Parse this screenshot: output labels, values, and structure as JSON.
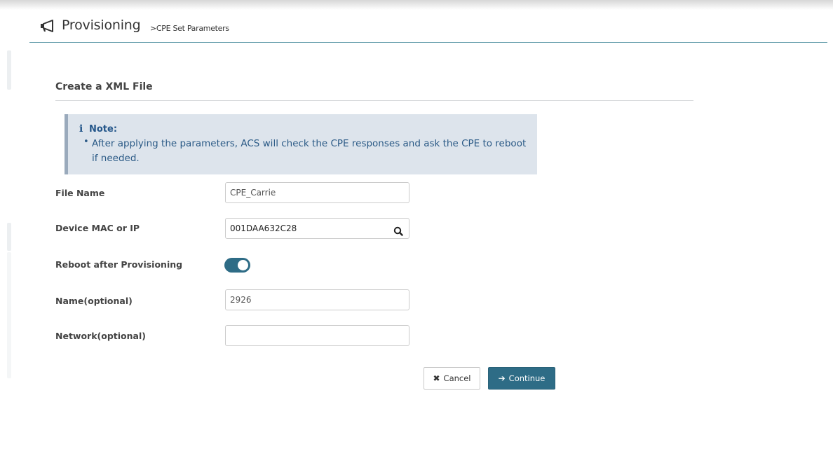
{
  "header": {
    "title": "Provisioning",
    "subtitle": ">CPE Set Parameters",
    "icon": "megaphone-icon"
  },
  "section": {
    "title": "Create a XML File"
  },
  "note": {
    "title": "Note:",
    "icon": "info-icon",
    "bullet": "•",
    "text": "After applying the parameters, ACS will check the CPE responses and ask the CPE to reboot if needed."
  },
  "form": {
    "file_name": {
      "label": "File Name",
      "value": "CPE_Carrie"
    },
    "device": {
      "label": "Device MAC or IP",
      "value": "001DAA632C28",
      "icon": "search-icon"
    },
    "reboot": {
      "label": "Reboot after Provisioning",
      "enabled": true
    },
    "name": {
      "label": "Name(optional)",
      "value": "2926"
    },
    "network": {
      "label": "Network(optional)",
      "value": ""
    }
  },
  "buttons": {
    "cancel_icon": "✖",
    "cancel_label": "Cancel",
    "continue_icon": "➔",
    "continue_label": "Continue"
  },
  "colors": {
    "accent": "#2e6c86",
    "note_bg": "#dde4ec",
    "note_text": "#2b5a86",
    "rule": "#5e9aa8"
  }
}
